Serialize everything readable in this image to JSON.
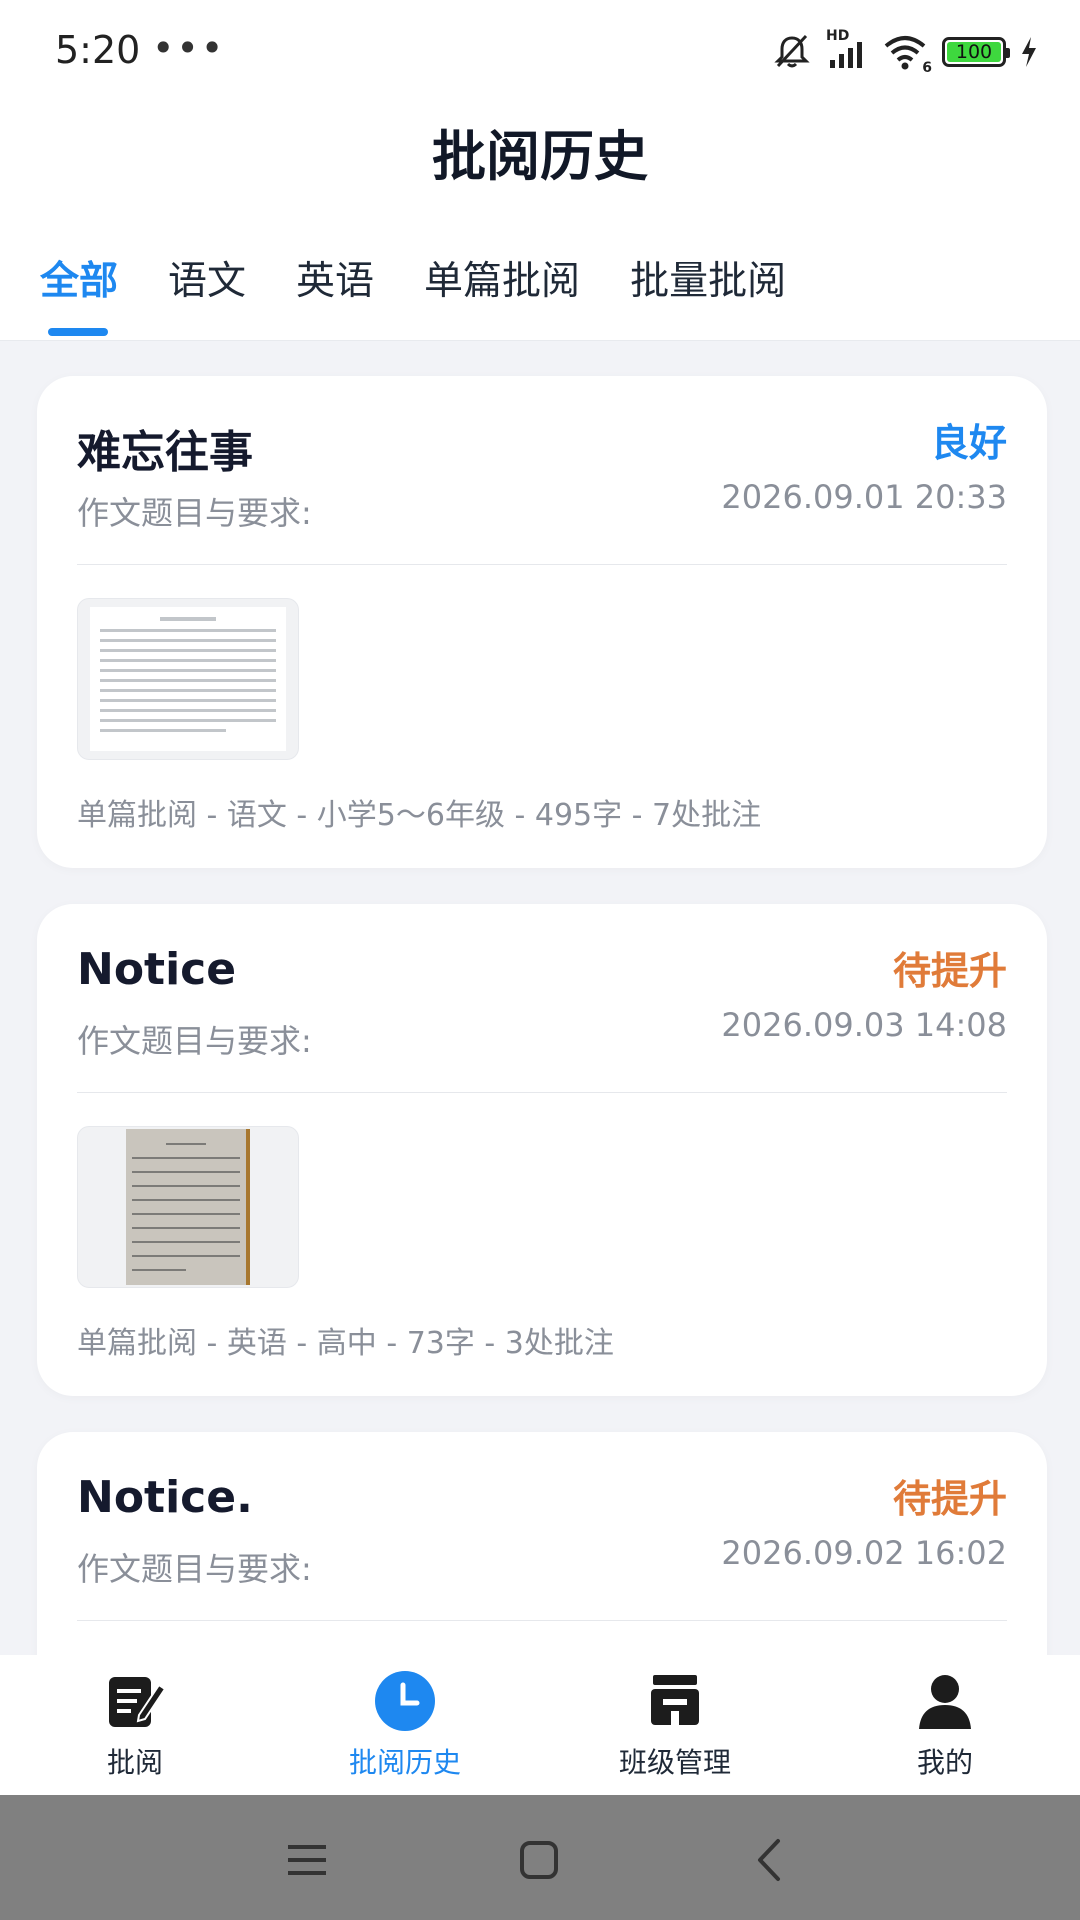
{
  "status": {
    "time": "5:20",
    "dots": "•••",
    "network_badge": "HD",
    "wifi_badge": "6",
    "battery_level": "100"
  },
  "header": {
    "title": "批阅历史"
  },
  "tabs": [
    {
      "label": "全部",
      "active": true
    },
    {
      "label": "语文",
      "active": false
    },
    {
      "label": "英语",
      "active": false
    },
    {
      "label": "单篇批阅",
      "active": false
    },
    {
      "label": "批量批阅",
      "active": false
    }
  ],
  "cards": [
    {
      "title": "难忘往事",
      "subtitle": "作文题目与要求:",
      "grade": "良好",
      "grade_color": "#1e88f0",
      "date": "2026.09.01 20:33",
      "meta": "单篇批阅 - 语文 - 小学5～6年级 - 495字 - 7处批注"
    },
    {
      "title": "Notice",
      "subtitle": "作文题目与要求:",
      "grade": "待提升",
      "grade_color": "#e07b39",
      "date": "2026.09.03 14:08",
      "meta": "单篇批阅 - 英语 - 高中 - 73字 - 3处批注"
    },
    {
      "title": "Notice.",
      "subtitle": "作文题目与要求:",
      "grade": "待提升",
      "grade_color": "#e07b39",
      "date": "2026.09.02 16:02"
    }
  ],
  "bottom_nav": [
    {
      "label": "批阅",
      "icon": "edit-doc-icon",
      "active": false
    },
    {
      "label": "批阅历史",
      "icon": "clock-icon",
      "active": true
    },
    {
      "label": "班级管理",
      "icon": "class-icon",
      "active": false
    },
    {
      "label": "我的",
      "icon": "profile-icon",
      "active": false
    }
  ],
  "colors": {
    "accent": "#1e88f0",
    "warn": "#e07b39",
    "good": "#1e88f0"
  }
}
